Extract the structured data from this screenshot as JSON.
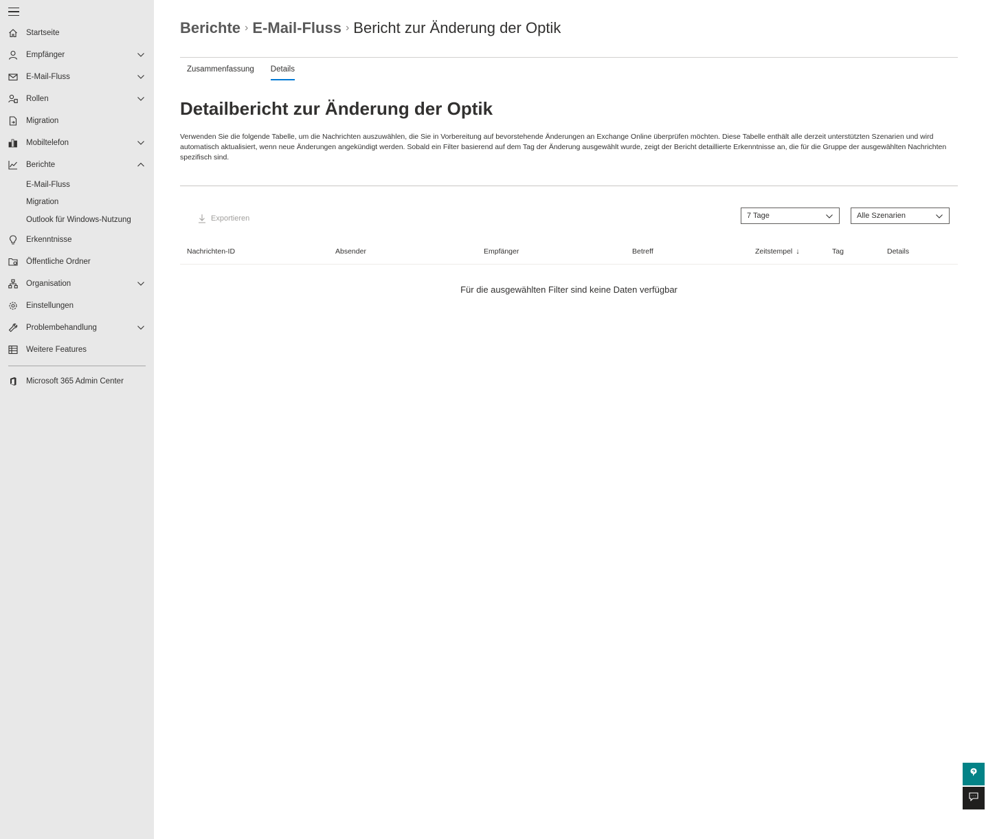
{
  "sidebar": {
    "items": [
      {
        "label": "Startseite",
        "icon": "home-icon",
        "chevron": false
      },
      {
        "label": "Empfänger",
        "icon": "person-icon",
        "chevron": true
      },
      {
        "label": "E-Mail-Fluss",
        "icon": "mail-icon",
        "chevron": true
      },
      {
        "label": "Rollen",
        "icon": "roles-icon",
        "chevron": true
      },
      {
        "label": "Migration",
        "icon": "migration-icon",
        "chevron": false
      },
      {
        "label": "Mobiltelefon",
        "icon": "mobile-icon",
        "chevron": true
      },
      {
        "label": "Berichte",
        "icon": "chart-icon",
        "chevron": true,
        "expanded": true
      }
    ],
    "berichte_subitems": [
      "E-Mail-Fluss",
      "Migration",
      "Outlook für Windows-Nutzung"
    ],
    "items_after": [
      {
        "label": "Erkenntnisse",
        "icon": "lightbulb-icon",
        "chevron": false
      },
      {
        "label": "Öffentliche Ordner",
        "icon": "folder-icon",
        "chevron": false
      },
      {
        "label": "Organisation",
        "icon": "organization-icon",
        "chevron": true
      },
      {
        "label": "Einstellungen",
        "icon": "gear-icon",
        "chevron": false
      },
      {
        "label": "Problembehandlung",
        "icon": "wrench-icon",
        "chevron": true
      },
      {
        "label": "Weitere Features",
        "icon": "table-icon",
        "chevron": false
      }
    ],
    "admin_center": {
      "label": "Microsoft 365 Admin Center",
      "icon": "office-icon"
    }
  },
  "breadcrumb": {
    "level1": "Berichte",
    "level2": "E-Mail-Fluss",
    "current": "Bericht zur Änderung der Optik"
  },
  "tabs": [
    {
      "label": "Zusammenfassung",
      "active": false
    },
    {
      "label": "Details",
      "active": true
    }
  ],
  "page": {
    "title": "Detailbericht zur Änderung der Optik",
    "description": "Verwenden Sie die folgende Tabelle, um die Nachrichten auszuwählen, die Sie in Vorbereitung auf bevorstehende Änderungen an Exchange Online überprüfen möchten. Diese Tabelle enthält alle derzeit unterstützten Szenarien und wird automatisch aktualisiert, wenn neue Änderungen angekündigt werden. Sobald ein Filter basierend auf dem Tag der Änderung ausgewählt wurde, zeigt der Bericht detaillierte Erkenntnisse an, die für die Gruppe der ausgewählten Nachrichten spezifisch sind."
  },
  "toolbar": {
    "export_label": "Exportieren",
    "days_filter": "7 Tage",
    "scenario_filter": "Alle Szenarien"
  },
  "table": {
    "columns": [
      "Nachrichten-ID",
      "Absender",
      "Empfänger",
      "Betreff",
      "Zeitstempel",
      "Tag",
      "Details"
    ],
    "sorted_column": "Zeitstempel",
    "sort_direction": "descending",
    "empty_message": "Für die ausgewählten Filter sind keine Daten verfügbar"
  },
  "colors": {
    "sidebar_bg": "#e8e8e8",
    "accent": "#0078d4",
    "help_button": "#038387",
    "chat_button": "#201f1e"
  }
}
